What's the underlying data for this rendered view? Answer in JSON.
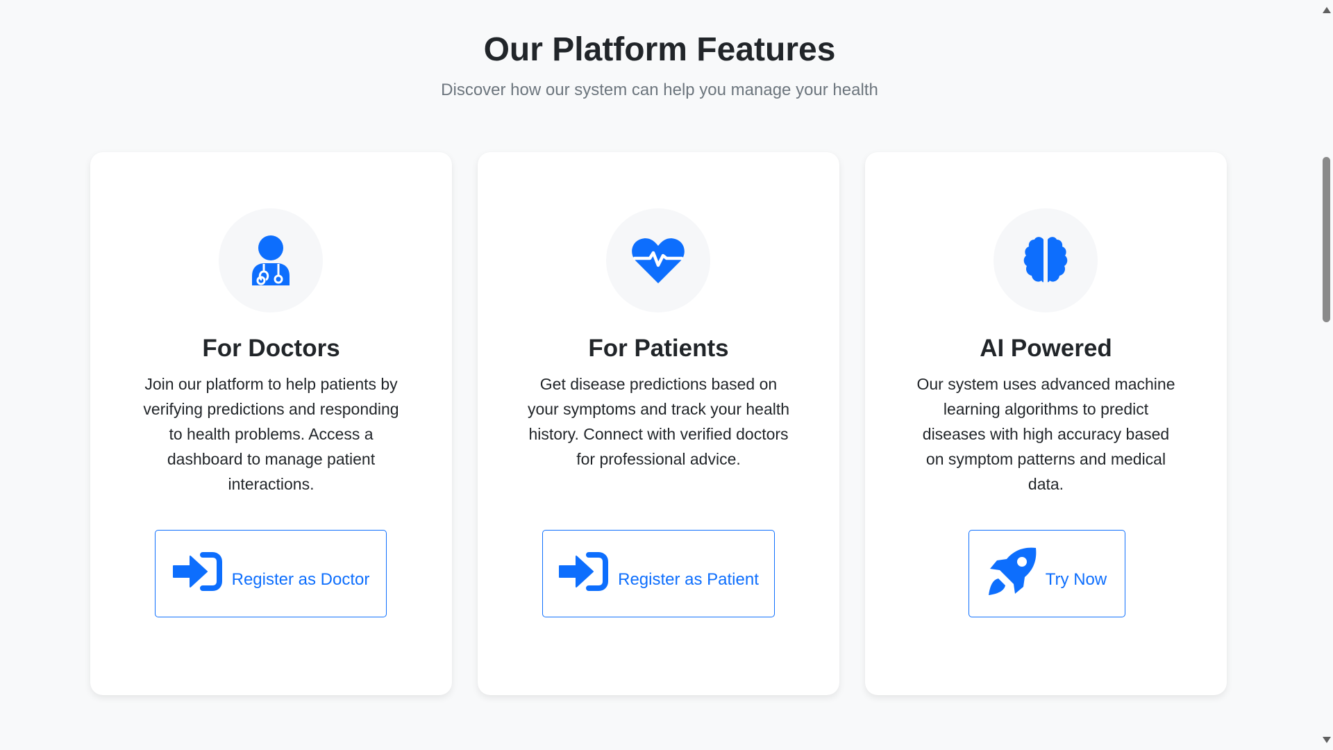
{
  "header": {
    "title": "Our Platform Features",
    "subtitle": "Discover how our system can help you manage your health"
  },
  "accent_color": "#0d6efd",
  "cards": [
    {
      "icon": "user-doctor-icon",
      "title": "For Doctors",
      "text": "Join our platform to help patients by verifying predictions and responding to health problems. Access a dashboard to manage patient interactions.",
      "button": {
        "icon": "sign-in-icon",
        "label": "Register as Doctor"
      }
    },
    {
      "icon": "heart-pulse-icon",
      "title": "For Patients",
      "text": "Get disease predictions based on your symptoms and track your health history. Connect with verified doctors for professional advice.",
      "button": {
        "icon": "sign-in-icon",
        "label": "Register as Patient"
      }
    },
    {
      "icon": "brain-icon",
      "title": "AI Powered",
      "text": "Our system uses advanced machine learning algorithms to predict diseases with high accuracy based on symptom patterns and medical data.",
      "button": {
        "icon": "rocket-icon",
        "label": "Try Now"
      }
    }
  ]
}
